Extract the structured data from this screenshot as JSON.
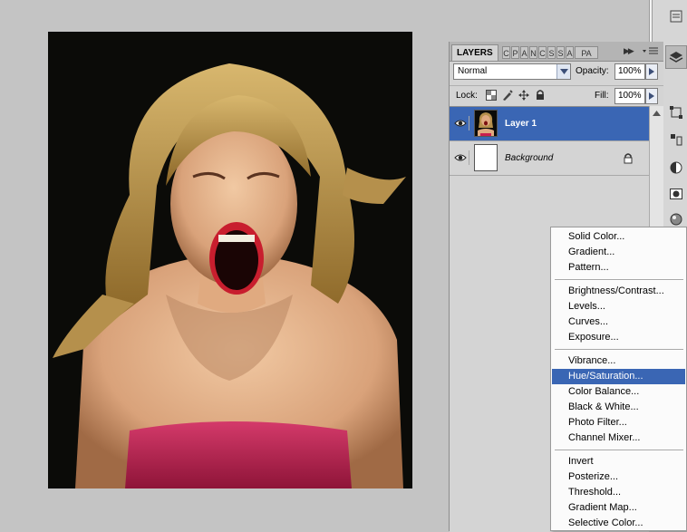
{
  "layers_panel": {
    "tabs": [
      "LAYERS",
      "C",
      "P",
      "A",
      "N",
      "C",
      "S",
      "S",
      "A",
      "PA"
    ],
    "blend_mode": "Normal",
    "opacity_label": "Opacity:",
    "opacity_value": "100%",
    "lock_label": "Lock:",
    "fill_label": "Fill:",
    "fill_value": "100%",
    "layers": [
      {
        "name": "Layer 1",
        "selected": true,
        "visible": true
      },
      {
        "name": "Background",
        "selected": false,
        "visible": true,
        "locked": true
      }
    ]
  },
  "adjustment_menu": {
    "highlighted": "Hue/Saturation...",
    "groups": [
      [
        "Solid Color...",
        "Gradient...",
        "Pattern..."
      ],
      [
        "Brightness/Contrast...",
        "Levels...",
        "Curves...",
        "Exposure..."
      ],
      [
        "Vibrance...",
        "Hue/Saturation...",
        "Color Balance...",
        "Black & White...",
        "Photo Filter...",
        "Channel Mixer..."
      ],
      [
        "Invert",
        "Posterize...",
        "Threshold...",
        "Gradient Map...",
        "Selective Color..."
      ]
    ]
  },
  "icons": {
    "eye": "eye-icon",
    "lock": "lock-icon",
    "dropdown": "chevron-down-icon",
    "flyout": "triangle-right-icon"
  },
  "colors": {
    "selection": "#3a66b4",
    "panel_bg": "#d4d4d4",
    "workspace_bg": "#c4c4c4"
  }
}
